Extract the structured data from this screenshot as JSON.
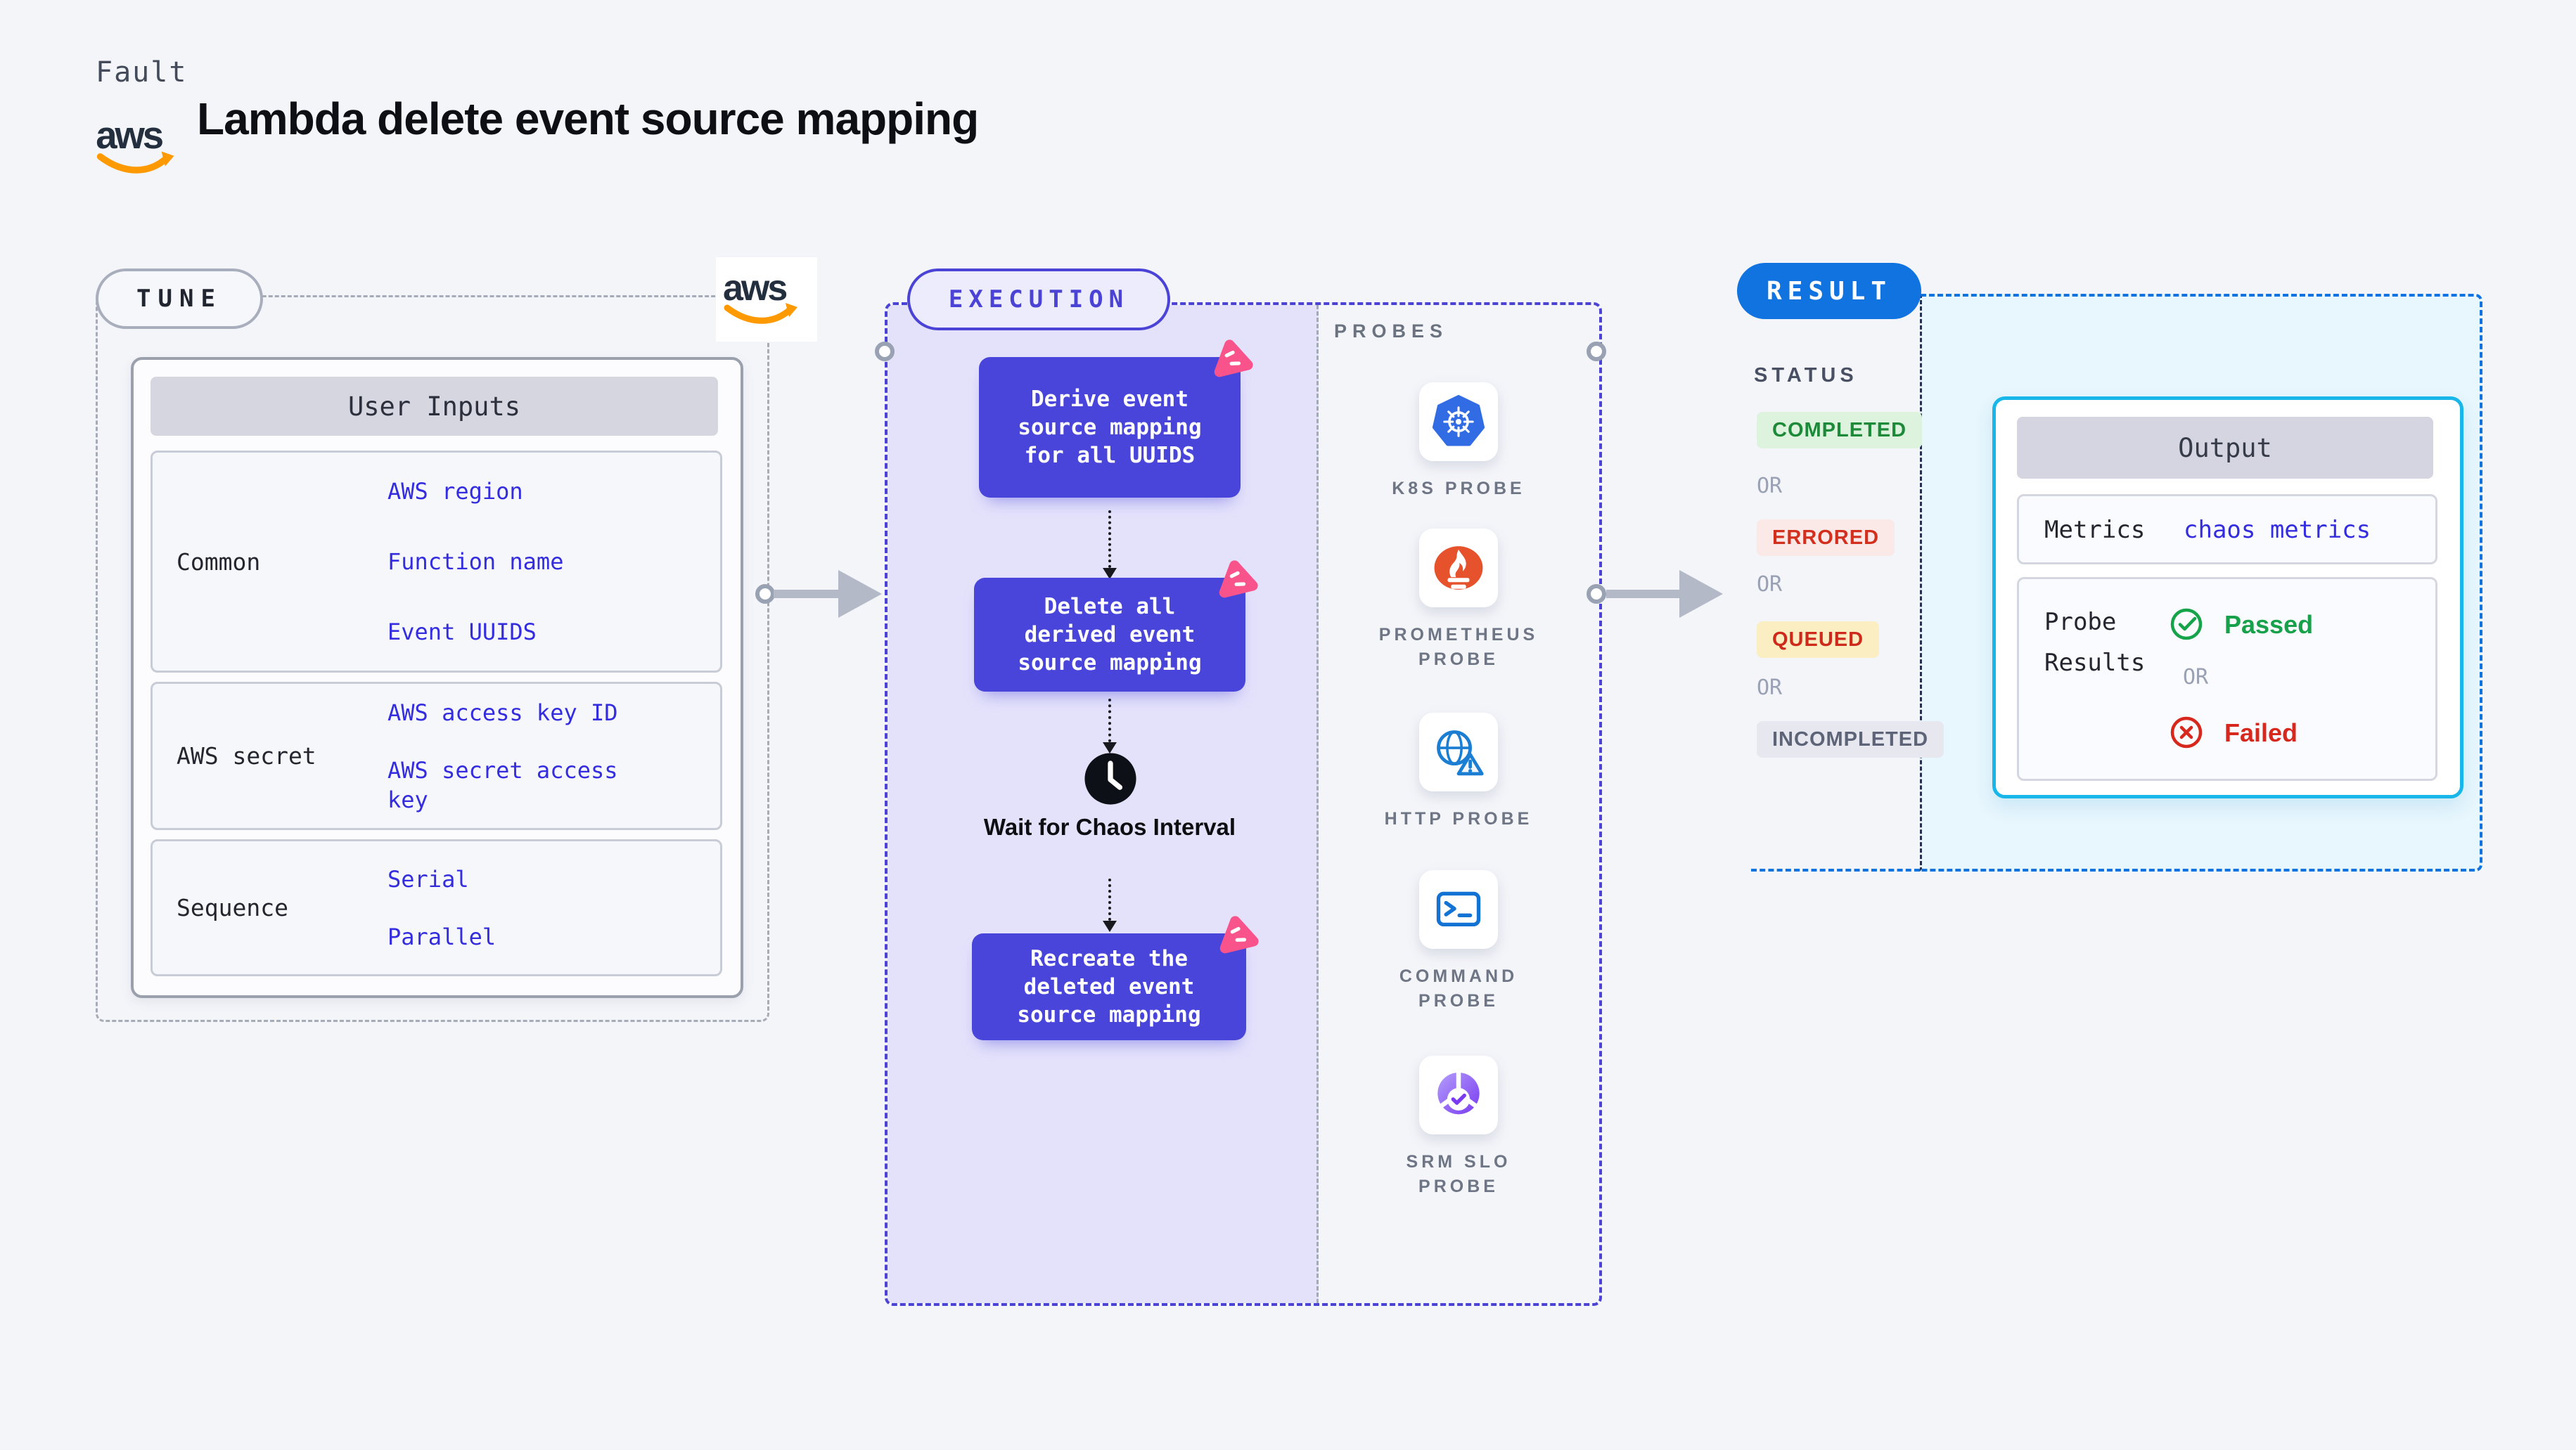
{
  "header": {
    "fault_label": "Fault",
    "title": "Lambda delete event source mapping",
    "aws_wordmark": "aws"
  },
  "tune": {
    "pill": "TUNE",
    "table": {
      "title": "User Inputs",
      "rows": [
        {
          "label": "Common",
          "values": [
            "AWS region",
            "Function name",
            "Event UUIDS"
          ]
        },
        {
          "label": "AWS secret",
          "values": [
            "AWS access key ID",
            "AWS secret access key"
          ]
        },
        {
          "label": "Sequence",
          "values": [
            "Serial",
            "Parallel"
          ]
        }
      ]
    }
  },
  "execution": {
    "pill": "EXECUTION",
    "step1": "Derive event source mapping for all UUIDS",
    "step2": "Delete all derived event source mapping",
    "wait_label": "Wait for Chaos Interval",
    "step3": "Recreate the deleted event source mapping"
  },
  "probes": {
    "title": "PROBES",
    "items": [
      {
        "label": "K8S PROBE",
        "icon": "kubernetes-icon"
      },
      {
        "label": "PROMETHEUS PROBE",
        "icon": "prometheus-icon"
      },
      {
        "label": "HTTP PROBE",
        "icon": "http-globe-icon"
      },
      {
        "label": "COMMAND PROBE",
        "icon": "terminal-icon"
      },
      {
        "label": "SRM SLO PROBE",
        "icon": "srm-slo-icon"
      }
    ]
  },
  "result": {
    "pill": "RESULT",
    "status_title": "STATUS",
    "or_label": "OR",
    "statuses": [
      {
        "label": "COMPLETED",
        "type": "success"
      },
      {
        "label": "ERRORED",
        "type": "error"
      },
      {
        "label": "QUEUED",
        "type": "warning"
      },
      {
        "label": "INCOMPLETED",
        "type": "neutral"
      }
    ],
    "output": {
      "title": "Output",
      "metrics_label": "Metrics",
      "metrics_value": "chaos metrics",
      "probe_results_label": "Probe Results",
      "passed_label": "Passed",
      "failed_label": "Failed"
    }
  },
  "colors": {
    "page_bg": "#f4f5f9",
    "accent_indigo": "#4a43d6",
    "step_box_indigo": "#4a45da",
    "execution_panel_lavender": "#e4e2fb",
    "link_blue": "#342de0",
    "chaos_badge_pink": "#f8548b",
    "result_blue": "#1173e0",
    "output_border_cyan": "#19b7e9",
    "result_panel_cyan": "#e8f6fd",
    "success_green": "#1d8a3a",
    "error_red": "#d32f1f",
    "warning_bg": "#faeec2",
    "neutral_gray": "#5d6477",
    "kubernetes_blue": "#326ce5",
    "prometheus_orange": "#e6522c",
    "aws_orange": "#ff9900"
  }
}
